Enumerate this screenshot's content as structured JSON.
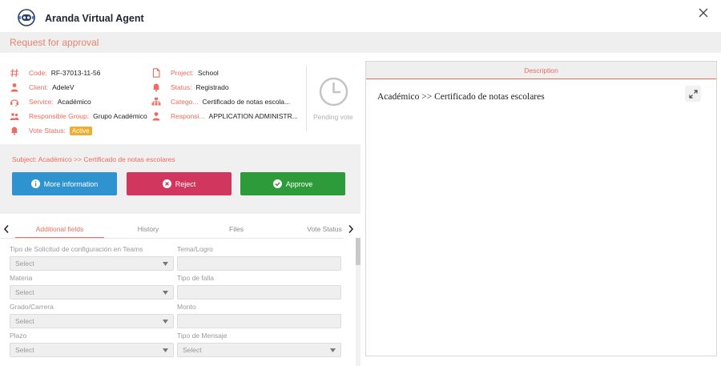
{
  "app": {
    "title": "Aranda Virtual Agent"
  },
  "page": {
    "title": "Request for approval"
  },
  "fields_left": [
    {
      "icon": "hash-icon",
      "label": "Code:",
      "value": "RF-37013-11-56"
    },
    {
      "icon": "user-icon",
      "label": "Client:",
      "value": "AdeleV"
    },
    {
      "icon": "service-icon",
      "label": "Service:",
      "value": "Académico"
    },
    {
      "icon": "group-icon",
      "label": "Responsible Group:",
      "value": "Grupo Académico"
    },
    {
      "icon": "bell-icon",
      "label": "Vote Status:",
      "value": "Active"
    }
  ],
  "fields_right": [
    {
      "icon": "document-icon",
      "label": "Project:",
      "value": "School"
    },
    {
      "icon": "status-icon",
      "label": "Status:",
      "value": "Registrado"
    },
    {
      "icon": "category-icon",
      "label": "Catego...",
      "value": "Certificado de notas escola..."
    },
    {
      "icon": "user-icon",
      "label": "Responsi...",
      "value": "APPLICATION ADMINISTR..."
    }
  ],
  "vote": {
    "label": "Pending vote"
  },
  "subject": {
    "label": "Subject:",
    "value": "Académico >> Certificado de notas escolares"
  },
  "actions": {
    "more_info": "More information",
    "reject": "Reject",
    "approve": "Approve"
  },
  "tabs": [
    {
      "label": "Additional fields",
      "active": true
    },
    {
      "label": "History",
      "active": false
    },
    {
      "label": "Files",
      "active": false
    },
    {
      "label": "Vote Status",
      "active": false
    }
  ],
  "form": {
    "left": [
      {
        "label": "Tipo de Solicitud de configuración en Teams",
        "type": "select",
        "value": "Select"
      },
      {
        "label": "Materia",
        "type": "select",
        "value": "Select"
      },
      {
        "label": "Grado/Carrera",
        "type": "select",
        "value": "Select"
      },
      {
        "label": "Plazo",
        "type": "select",
        "value": "Select"
      }
    ],
    "right": [
      {
        "label": "Tema/Logro",
        "type": "input",
        "value": ""
      },
      {
        "label": "Tipo de falla",
        "type": "input",
        "value": ""
      },
      {
        "label": "Monto",
        "type": "input",
        "value": ""
      },
      {
        "label": "Tipo de Mensaje",
        "type": "select",
        "value": "Select"
      }
    ]
  },
  "description": {
    "title": "Description",
    "body": "Académico >> Certificado de notas escolares"
  },
  "colors": {
    "accent": "#ee6b5e",
    "info": "#2f93cf",
    "reject": "#d1375e",
    "approve": "#2e9b3a",
    "active_badge": "#f0ad2e"
  }
}
